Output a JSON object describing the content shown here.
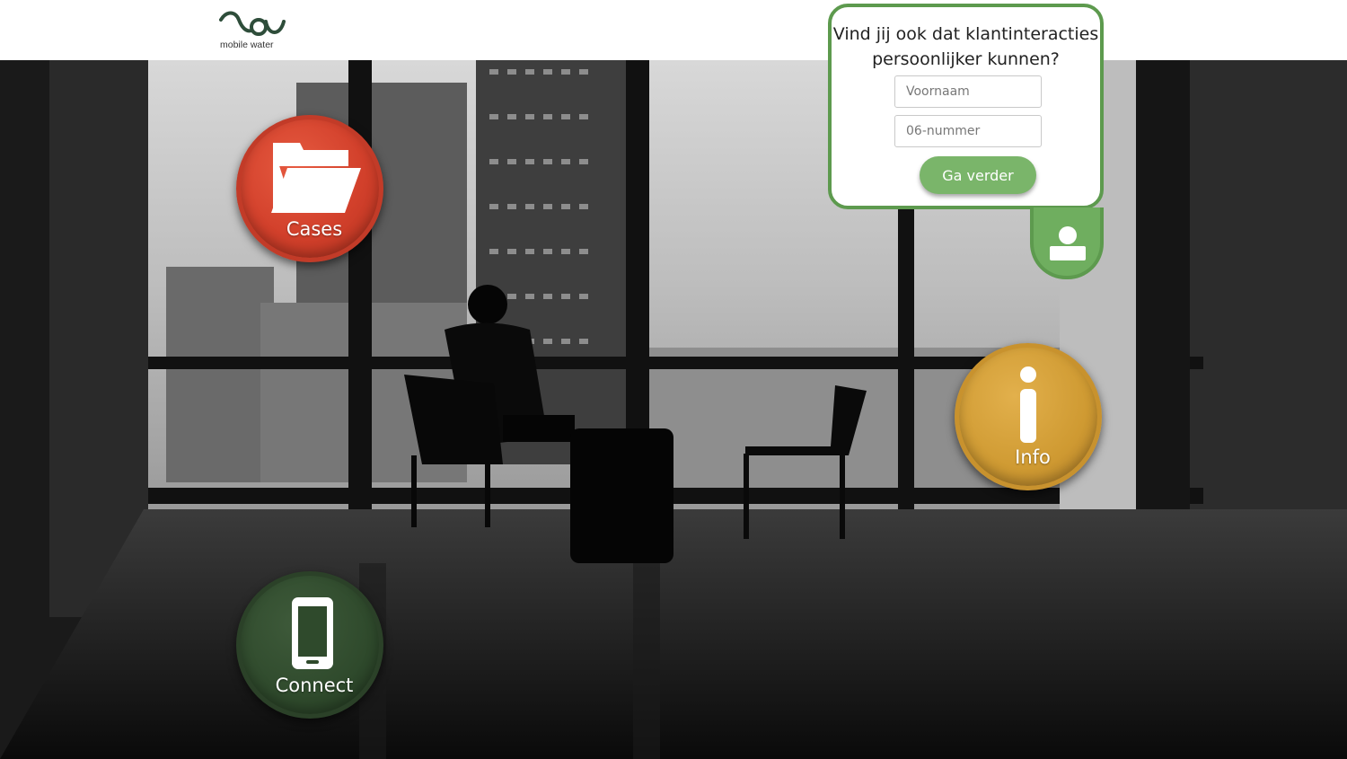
{
  "header": {
    "logo_text": "mobile water"
  },
  "nav_buttons": {
    "cases": {
      "label": "Cases",
      "color": "#d2402b",
      "icon": "folder-icon"
    },
    "info": {
      "label": "Info",
      "color": "#cf9a32",
      "icon": "info-icon"
    },
    "connect": {
      "label": "Connect",
      "color": "#2f4a2c",
      "icon": "phone-icon"
    }
  },
  "contact_form": {
    "title_line1": "Vind jij ook dat klantinteracties",
    "title_line2": "persoonlijker kunnen?",
    "first_name_placeholder": "Voornaam",
    "phone_placeholder": "06-nummer",
    "submit_label": "Ga verder",
    "accent_color": "#5d9a4e",
    "tab_icon": "user-icon"
  }
}
